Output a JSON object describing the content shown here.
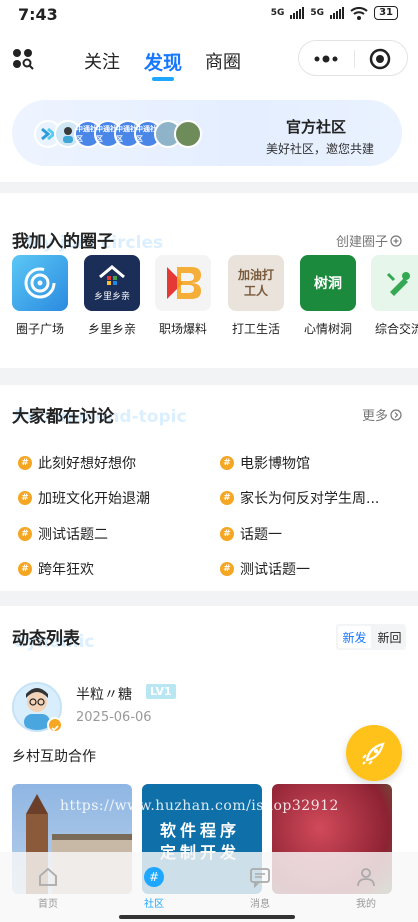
{
  "status": {
    "time": "7:43",
    "net1": "5G",
    "net2": "5G",
    "battery": "31"
  },
  "topnav": {
    "tabs": [
      "关注",
      "发现",
      "商圈"
    ],
    "active": "发现"
  },
  "banner": {
    "title": "官方社区",
    "subtitle": "美好社区，邀您共建",
    "avatar_texts": [
      "中通社区",
      "中通社区",
      "中通社区",
      "中通社区"
    ]
  },
  "joined": {
    "title": "我加入的圈子",
    "ghost": "My join circles",
    "create_label": "创建圈子",
    "items": [
      {
        "label": "圈子广场",
        "icon": "circle-plaza-icon"
      },
      {
        "label": "乡里乡亲",
        "icon": "village-icon",
        "logo_text": "乡里乡亲"
      },
      {
        "label": "职场爆料",
        "icon": "workplace-icon"
      },
      {
        "label": "打工生活",
        "icon": "worker-life-icon",
        "logo_text": "加油打工人"
      },
      {
        "label": "心情树洞",
        "icon": "tree-hole-icon",
        "logo_text": "树洞"
      },
      {
        "label": "综合交流",
        "icon": "general-chat-icon"
      }
    ]
  },
  "topics": {
    "title": "大家都在讨论",
    "ghost": "Recommend-topic",
    "more_label": "更多",
    "left": [
      "此刻好想好想你",
      "加班文化开始退潮",
      "测试话题二",
      "跨年狂欢"
    ],
    "right": [
      "电影博物馆",
      "家长为何反对学生周...",
      "话题一",
      "测试话题一"
    ]
  },
  "feed": {
    "title": "动态列表",
    "ghost": "dynamic",
    "sort_new": "新发",
    "sort_reply": "新回",
    "post": {
      "author": "半粒〃糖",
      "level": "LV1",
      "date": "2025-06-06",
      "content": "乡村互助合作",
      "image2_text": [
        "软件程序",
        "定制开发"
      ]
    }
  },
  "watermark": "https://www.huzhan.com/ishop32912",
  "tabbar": [
    {
      "label": "首页",
      "icon": "home-icon"
    },
    {
      "label": "社区",
      "icon": "community-icon"
    },
    {
      "label": "消息",
      "icon": "message-icon"
    },
    {
      "label": "我的",
      "icon": "profile-icon"
    }
  ],
  "colors": {
    "accent": "#1677ff",
    "tab_active": "#1ea7ff",
    "hash": "#f5a623",
    "fab": "#ffc21a"
  }
}
